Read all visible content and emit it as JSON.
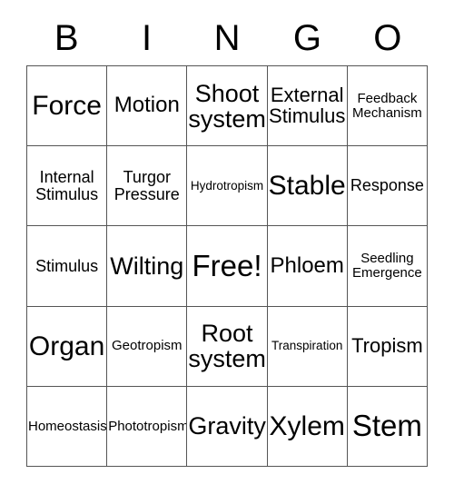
{
  "card": {
    "title": "BINGO",
    "header_letters": [
      "B",
      "I",
      "N",
      "G",
      "O"
    ],
    "grid_size": "5x5",
    "free_space": "Free!",
    "colors": {
      "text": "#000000",
      "grid_line": "#555555",
      "background": "#ffffff"
    },
    "rows": [
      [
        {
          "label": "Force",
          "size": "fs-xl"
        },
        {
          "label": "Motion",
          "size": "fs-md"
        },
        {
          "label": "Shoot\nsystem",
          "size": "fs-lg"
        },
        {
          "label": "External\nStimulus",
          "size": "fs-sm"
        },
        {
          "label": "Feedback\nMechanism",
          "size": "fs-xxs"
        }
      ],
      [
        {
          "label": "Internal\nStimulus",
          "size": "fs-xs"
        },
        {
          "label": "Turgor\nPressure",
          "size": "fs-xs"
        },
        {
          "label": "Hydrotropism",
          "size": "fs-tiny"
        },
        {
          "label": "Stable",
          "size": "fs-xl"
        },
        {
          "label": "Response",
          "size": "fs-xs"
        }
      ],
      [
        {
          "label": "Stimulus",
          "size": "fs-xs"
        },
        {
          "label": "Wilting",
          "size": "fs-lg"
        },
        {
          "label": "Free!",
          "size": "fs-xxl"
        },
        {
          "label": "Phloem",
          "size": "fs-md"
        },
        {
          "label": "Seedling\nEmergence",
          "size": "fs-xxs"
        }
      ],
      [
        {
          "label": "Organ",
          "size": "fs-xl"
        },
        {
          "label": "Geotropism",
          "size": "fs-xxs"
        },
        {
          "label": "Root\nsystem",
          "size": "fs-lg"
        },
        {
          "label": "Transpiration",
          "size": "fs-tiny"
        },
        {
          "label": "Tropism",
          "size": "fs-sm"
        }
      ],
      [
        {
          "label": "Homeostasis",
          "size": "fs-xxs"
        },
        {
          "label": "Phototropism",
          "size": "fs-xxs"
        },
        {
          "label": "Gravity",
          "size": "fs-lg"
        },
        {
          "label": "Xylem",
          "size": "fs-xl"
        },
        {
          "label": "Stem",
          "size": "fs-xxl"
        }
      ]
    ]
  }
}
